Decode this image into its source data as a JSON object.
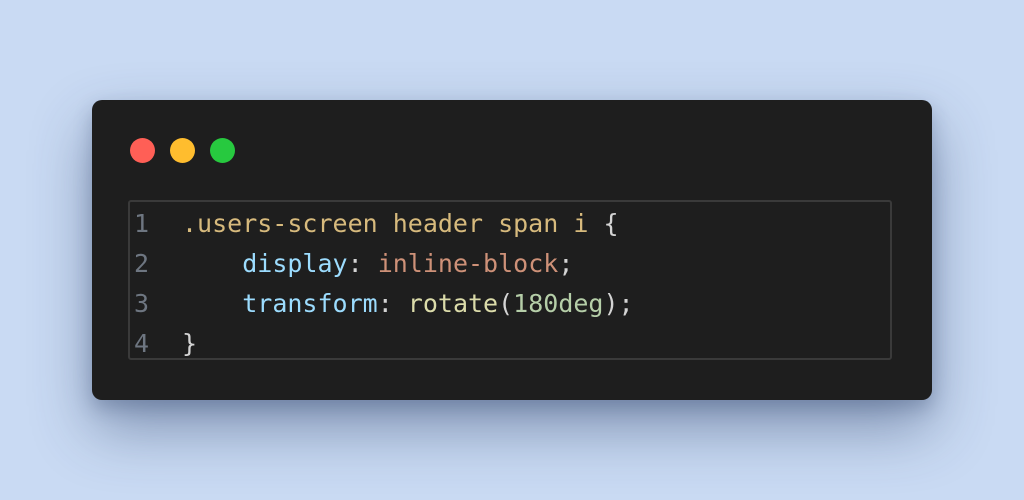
{
  "window": {
    "controls": [
      {
        "name": "close",
        "color": "#ff5f56"
      },
      {
        "name": "minimize",
        "color": "#ffbd2e"
      },
      {
        "name": "maximize",
        "color": "#27c93f"
      }
    ]
  },
  "code": {
    "language": "css",
    "lines": [
      {
        "number": "1",
        "tokens": [
          {
            "text": ".users-screen header span i",
            "type": "selector"
          },
          {
            "text": " {",
            "type": "punct"
          }
        ]
      },
      {
        "number": "2",
        "tokens": [
          {
            "text": "    ",
            "type": "punct"
          },
          {
            "text": "display",
            "type": "prop"
          },
          {
            "text": ": ",
            "type": "punct"
          },
          {
            "text": "inline-block",
            "type": "value"
          },
          {
            "text": ";",
            "type": "punct"
          }
        ]
      },
      {
        "number": "3",
        "tokens": [
          {
            "text": "    ",
            "type": "punct"
          },
          {
            "text": "transform",
            "type": "prop"
          },
          {
            "text": ": ",
            "type": "punct"
          },
          {
            "text": "rotate",
            "type": "func"
          },
          {
            "text": "(",
            "type": "punct"
          },
          {
            "text": "180deg",
            "type": "num"
          },
          {
            "text": ");",
            "type": "punct"
          }
        ]
      },
      {
        "number": "4",
        "tokens": [
          {
            "text": "}",
            "type": "punct"
          }
        ]
      }
    ]
  }
}
